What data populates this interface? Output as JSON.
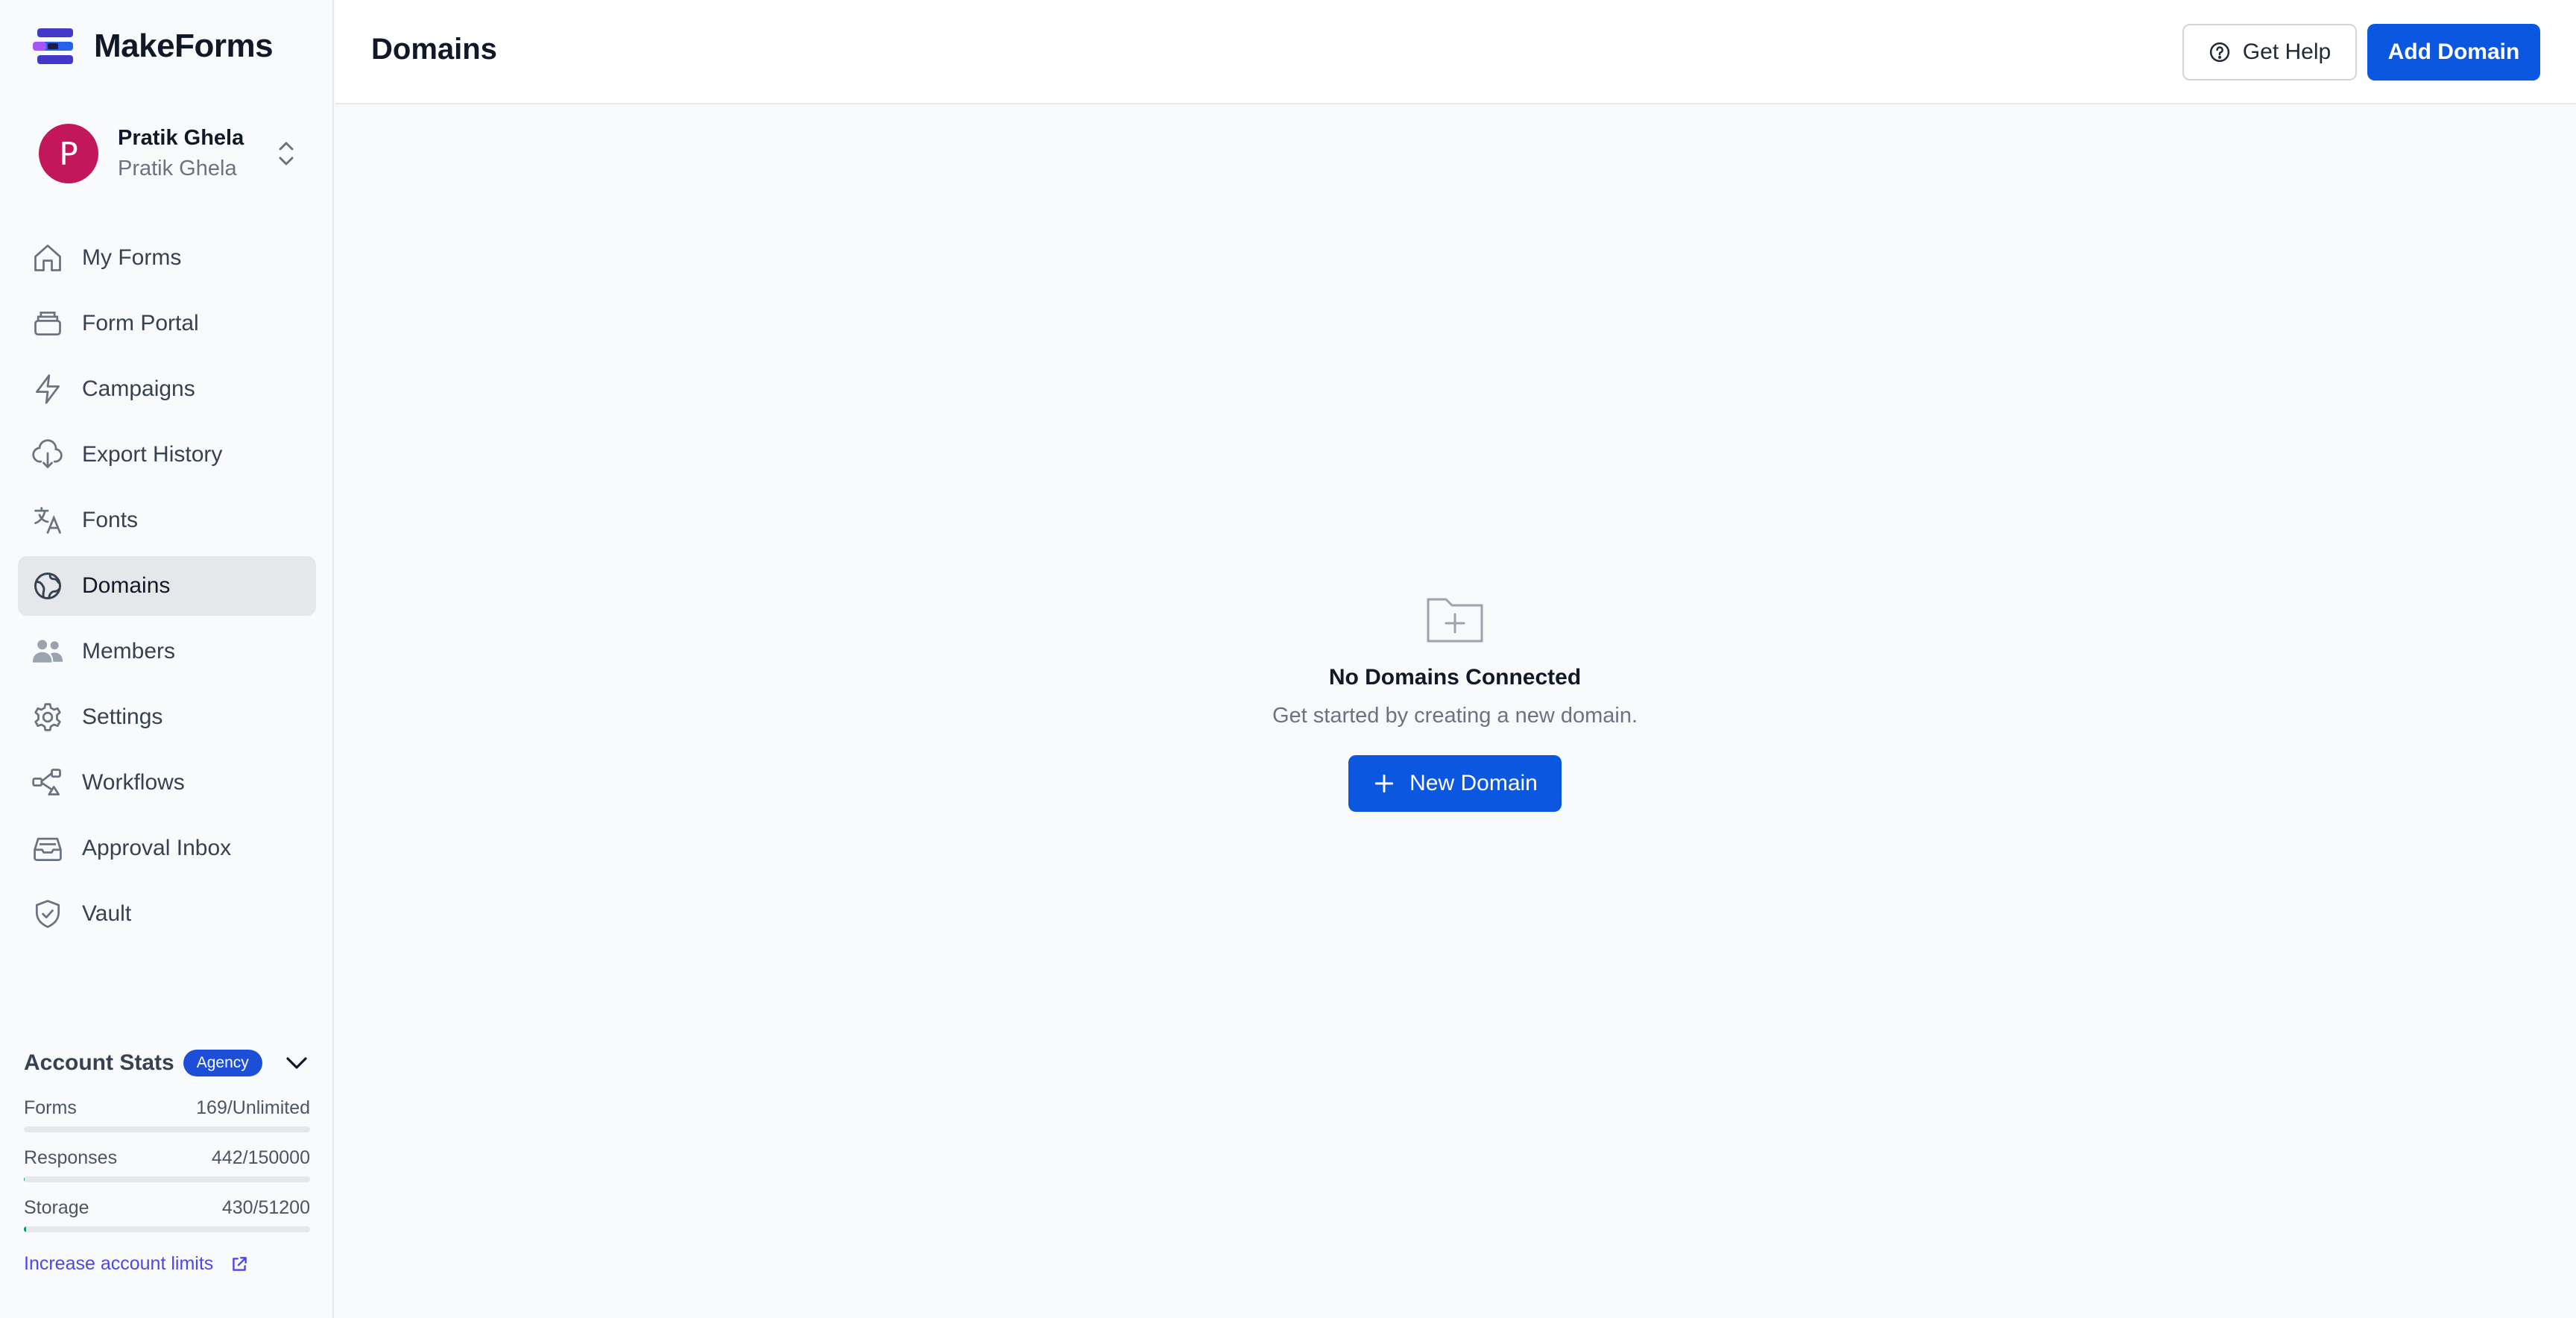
{
  "brand": {
    "name": "MakeForms",
    "icon": "makeforms-logo"
  },
  "profile": {
    "initial": "P",
    "name": "Pratik Ghela",
    "workspace": "Pratik Ghela",
    "avatar_color": "#c2185b"
  },
  "nav": {
    "items": [
      {
        "label": "My Forms",
        "icon": "home-icon"
      },
      {
        "label": "Form Portal",
        "icon": "portal-icon"
      },
      {
        "label": "Campaigns",
        "icon": "bolt-icon"
      },
      {
        "label": "Export History",
        "icon": "cloud-download-icon"
      },
      {
        "label": "Fonts",
        "icon": "translate-icon"
      },
      {
        "label": "Domains",
        "icon": "globe-icon"
      },
      {
        "label": "Members",
        "icon": "users-icon"
      },
      {
        "label": "Settings",
        "icon": "gear-icon"
      },
      {
        "label": "Workflows",
        "icon": "workflow-icon"
      },
      {
        "label": "Approval Inbox",
        "icon": "inbox-icon"
      },
      {
        "label": "Vault",
        "icon": "shield-icon"
      }
    ],
    "active": "Domains"
  },
  "header": {
    "title": "Domains",
    "help_label": "Get Help",
    "add_label": "Add Domain"
  },
  "empty_state": {
    "title": "No Domains Connected",
    "description": "Get started by creating a new domain.",
    "button_label": "New Domain"
  },
  "stats": {
    "title": "Account Stats",
    "plan_badge": "Agency",
    "rows": [
      {
        "label": "Forms",
        "value": "169/Unlimited",
        "fraction": 0
      },
      {
        "label": "Responses",
        "value": "442/150000",
        "fraction": 0.003
      },
      {
        "label": "Storage",
        "value": "430/51200",
        "fraction": 0.008
      }
    ],
    "link_label": "Increase account limits"
  },
  "colors": {
    "accent": "#0b57e0",
    "badge": "#1d4ed8",
    "link": "#4f46e5",
    "progress": "#059669"
  }
}
